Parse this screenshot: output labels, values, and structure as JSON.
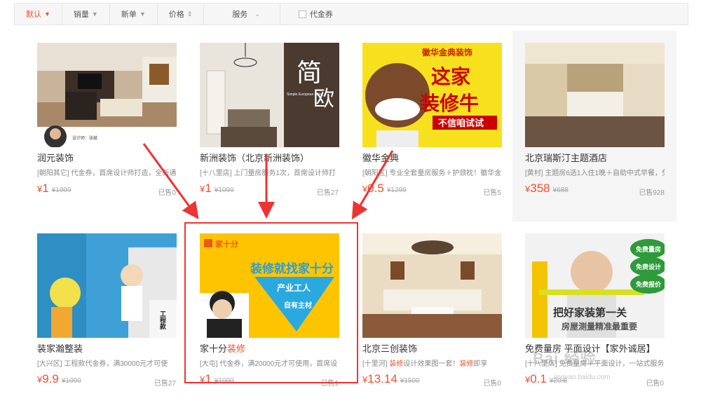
{
  "sort_bar": {
    "items": [
      {
        "label": "默认",
        "arrow": "🡇"
      },
      {
        "label": "销量",
        "arrow": "🡇"
      },
      {
        "label": "新单",
        "arrow": "🡇"
      },
      {
        "label": "价格",
        "arrow": "⬍"
      },
      {
        "label": "服务",
        "arrow": "⌄"
      }
    ],
    "voucher_label": "代金券"
  },
  "products": [
    {
      "title": "润元装饰",
      "desc": "[朝阳其它] 代金券，首席设计师打造，全新通",
      "currency": "¥",
      "price": "1",
      "orig": "¥1999",
      "sold": "已售0",
      "overlay": "设计师：张斌"
    },
    {
      "title": "新洲装饰（北京新洲装饰）",
      "desc": "[十八里店] 上门量房服务1次，首席设计师打",
      "currency": "¥",
      "price": "1",
      "orig": "¥1099",
      "sold": "已售27",
      "overlay_big1": "简",
      "overlay_big2": "欧",
      "overlay_en": "Simple European style"
    },
    {
      "title": "徽华金典",
      "desc": "[朝阳区] 专业全套量房服务＋护颈枕！徽华金",
      "currency": "¥",
      "price": "0.5",
      "orig": "¥1299",
      "sold": "已售5",
      "overlay_top": "徽华金典装饰",
      "overlay_l1": "这家",
      "overlay_l2": "装修牛",
      "overlay_l3": "不信咱试试"
    },
    {
      "title": "北京瑞斯汀主题酒店",
      "desc": "[黄村] 主题房6选1入住1晚＋自助中式早餐，免",
      "currency": "¥",
      "price": "358",
      "orig": "¥688",
      "sold": "已售928"
    },
    {
      "title": "装家瀚整装",
      "desc": "[大兴区] 工程款代金券，满30000元才可使",
      "currency": "¥",
      "price": "9.9",
      "orig": "¥1000",
      "sold": "已售27",
      "overlay_right": "工程款"
    },
    {
      "title_a": "家十分",
      "title_b": "装修",
      "desc": "[大屯] 代金券，满20000元才可使用，首席设",
      "currency": "¥",
      "price": "1",
      "orig": "¥1000",
      "sold": "已售1",
      "overlay_brand": "家十分",
      "overlay_l1": "装修就找家十分",
      "overlay_l2": "产业工人",
      "overlay_l3": "自有主材"
    },
    {
      "title": "北京三创装饰",
      "desc_a": "[十里河] ",
      "desc_b": "装修",
      "desc_c": "设计效果图一套！",
      "desc_d": "装修",
      "desc_e": "即享",
      "currency": "¥",
      "price": "13.14",
      "orig": "¥1500",
      "sold": "已售0"
    },
    {
      "title": "免费量房 平面设计【家外诚居】",
      "desc": "[十八里店] 免费量房＋平面设计，一站式服务",
      "currency": "¥",
      "price": "0.1",
      "orig": "¥20.8",
      "sold": "已售0",
      "overlay_badge1": "免费量房",
      "overlay_badge2": "免费设计",
      "overlay_badge3": "免费报价",
      "overlay_l1": "把好家装第一关",
      "overlay_l2": "房屋测量精准最重要"
    }
  ],
  "watermark": "Bai 经验",
  "watermark_url": "jingyan.baidu.com"
}
